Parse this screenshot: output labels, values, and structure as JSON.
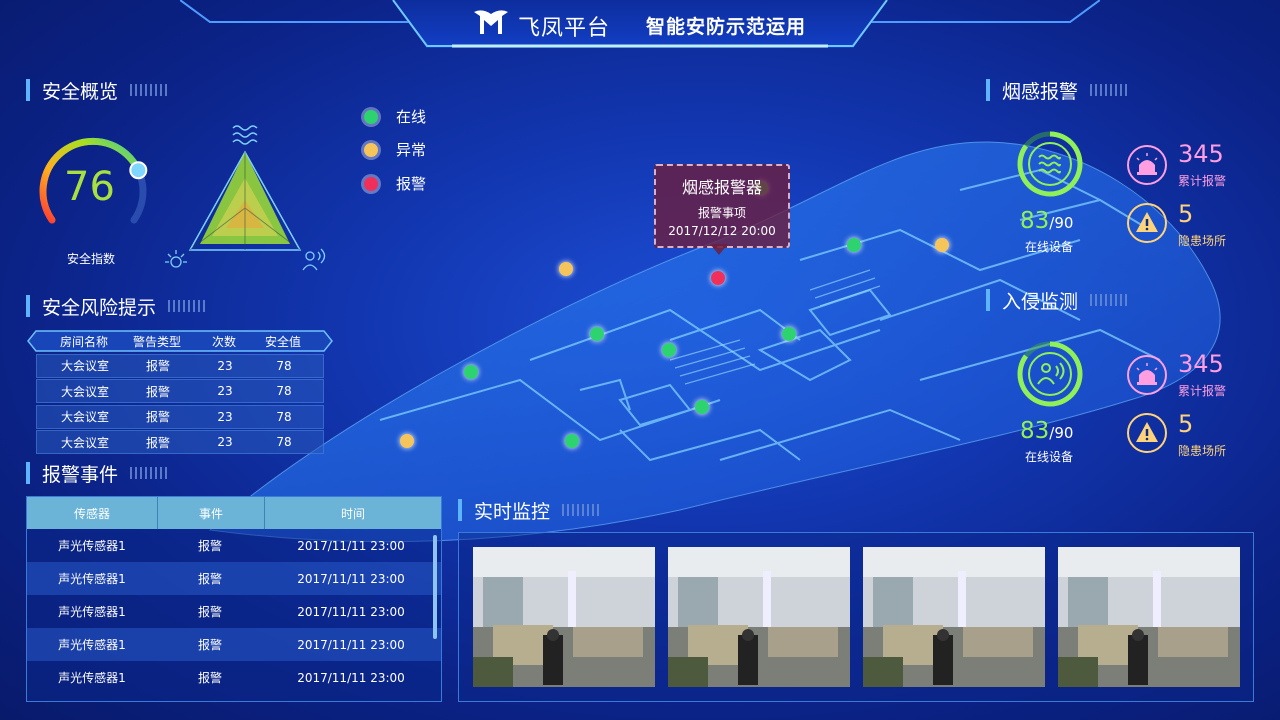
{
  "header": {
    "brand": "飞凤平台",
    "title": "智能安防示范运用"
  },
  "overview": {
    "title": "安全概览",
    "score": "76",
    "score_label": "安全指数",
    "score_value": 0.76
  },
  "legend": [
    {
      "label": "在线",
      "color": "#2dd36f"
    },
    {
      "label": "异常",
      "color": "#f5c45a"
    },
    {
      "label": "报警",
      "color": "#f0305a"
    }
  ],
  "risk": {
    "title": "安全风险提示",
    "headers": [
      "房间名称",
      "警告类型",
      "次数",
      "安全值"
    ],
    "rows": [
      [
        "大会议室",
        "报警",
        "23",
        "78"
      ],
      [
        "大会议室",
        "报警",
        "23",
        "78"
      ],
      [
        "大会议室",
        "报警",
        "23",
        "78"
      ],
      [
        "大会议室",
        "报警",
        "23",
        "78"
      ]
    ]
  },
  "events": {
    "title": "报警事件",
    "headers": [
      "传感器",
      "事件",
      "时间"
    ],
    "rows": [
      [
        "声光传感器1",
        "报警",
        "2017/11/11 23:00"
      ],
      [
        "声光传感器1",
        "报警",
        "2017/11/11 23:00"
      ],
      [
        "声光传感器1",
        "报警",
        "2017/11/11 23:00"
      ],
      [
        "声光传感器1",
        "报警",
        "2017/11/11 23:00"
      ],
      [
        "声光传感器1",
        "报警",
        "2017/11/11 23:00"
      ]
    ]
  },
  "monitor": {
    "title": "实时监控"
  },
  "tooltip": {
    "title": "烟感报警器",
    "line1": "报警事项",
    "line2": "2017/12/12 20:00"
  },
  "smoke": {
    "title": "烟感报警",
    "online": "83",
    "total": "/90",
    "online_label": "在线设备",
    "alarm_count": "345",
    "alarm_label": "累计报警",
    "hazard_count": "5",
    "hazard_label": "隐患场所"
  },
  "intrusion": {
    "title": "入侵监测",
    "online": "83",
    "total": "/90",
    "online_label": "在线设备",
    "alarm_count": "345",
    "alarm_label": "累计报警",
    "hazard_count": "5",
    "hazard_label": "隐患场所"
  }
}
